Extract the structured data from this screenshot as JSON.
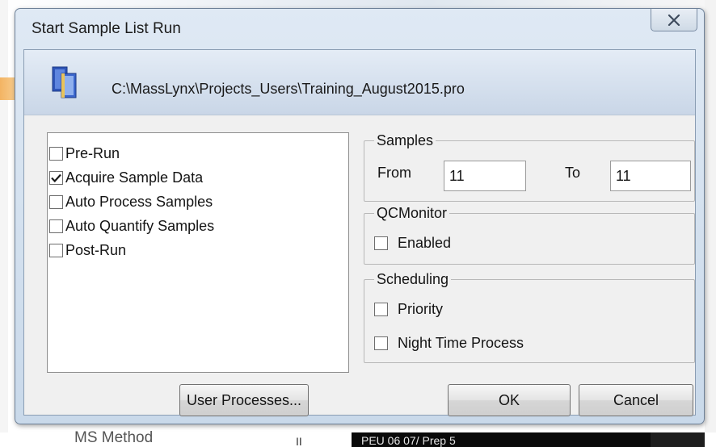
{
  "background": {
    "bottom_label": "MS Method",
    "bottom_mark": "II",
    "bottom_text": "PEU 06 07/ Prep 5"
  },
  "dialog": {
    "title": "Start Sample List Run",
    "close_glyph": "X",
    "project_path": "C:\\MassLynx\\Projects_Users\\Training_August2015.pro"
  },
  "options": [
    {
      "label": "Pre-Run",
      "checked": false
    },
    {
      "label": "Acquire Sample Data",
      "checked": true
    },
    {
      "label": "Auto Process Samples",
      "checked": false
    },
    {
      "label": "Auto Quantify Samples",
      "checked": false
    },
    {
      "label": "Post-Run",
      "checked": false
    }
  ],
  "samples": {
    "title": "Samples",
    "from_label": "From",
    "from_value": "11",
    "to_label": "To",
    "to_value": "11"
  },
  "qcmonitor": {
    "title": "QCMonitor",
    "enabled_label": "Enabled",
    "enabled_checked": false
  },
  "scheduling": {
    "title": "Scheduling",
    "priority_label": "Priority",
    "priority_checked": false,
    "night_label": "Night Time Process",
    "night_checked": false
  },
  "buttons": {
    "user_processes": "User Processes...",
    "ok": "OK",
    "cancel": "Cancel"
  },
  "colors": {
    "titlebar": "#dfe9f4",
    "client": "#f0f0f0",
    "icon_blue": "#3b5fc4",
    "check": "#1a1a1a"
  }
}
